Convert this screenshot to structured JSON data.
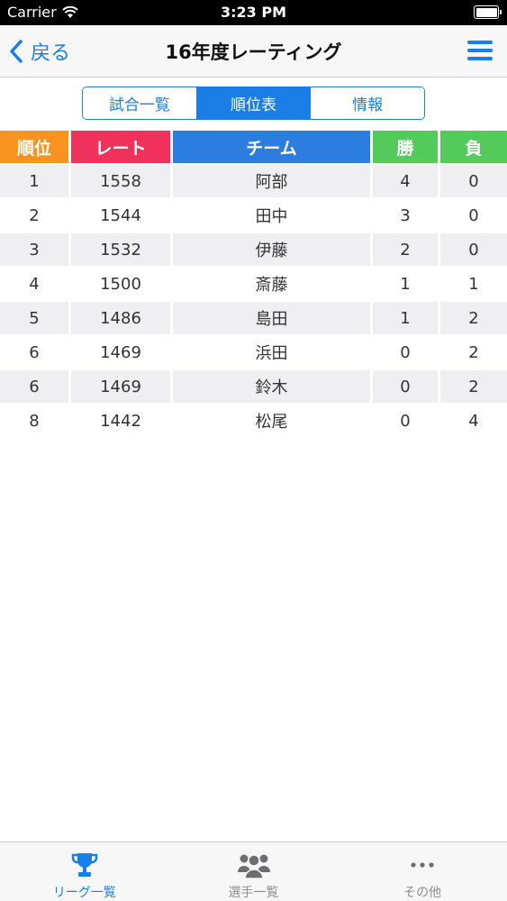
{
  "status_bar": {
    "carrier": "Carrier",
    "time": "3:23 PM"
  },
  "nav": {
    "back_label": "戻る",
    "title": "16年度レーティング"
  },
  "segments": [
    {
      "label": "試合一覧",
      "active": false
    },
    {
      "label": "順位表",
      "active": true
    },
    {
      "label": "情報",
      "active": false
    }
  ],
  "table": {
    "headers": [
      {
        "label": "順位",
        "color": "#f7931e"
      },
      {
        "label": "レート",
        "color": "#f0315b"
      },
      {
        "label": "チーム",
        "color": "#2d7de0"
      },
      {
        "label": "勝",
        "color": "#54c95c"
      },
      {
        "label": "負",
        "color": "#54c95c"
      }
    ],
    "rows": [
      [
        "1",
        "1558",
        "阿部",
        "4",
        "0"
      ],
      [
        "2",
        "1544",
        "田中",
        "3",
        "0"
      ],
      [
        "3",
        "1532",
        "伊藤",
        "2",
        "0"
      ],
      [
        "4",
        "1500",
        "斎藤",
        "1",
        "1"
      ],
      [
        "5",
        "1486",
        "島田",
        "1",
        "2"
      ],
      [
        "6",
        "1469",
        "浜田",
        "0",
        "2"
      ],
      [
        "6",
        "1469",
        "鈴木",
        "0",
        "2"
      ],
      [
        "8",
        "1442",
        "松尾",
        "0",
        "4"
      ]
    ]
  },
  "tabs": [
    {
      "label": "リーグ一覧",
      "icon": "trophy-icon",
      "active": true
    },
    {
      "label": "選手一覧",
      "icon": "people-icon",
      "active": false
    },
    {
      "label": "その他",
      "icon": "more-icon",
      "active": false
    }
  ],
  "colors": {
    "accent": "#1a7ee6",
    "inactive": "#8e8e93"
  }
}
